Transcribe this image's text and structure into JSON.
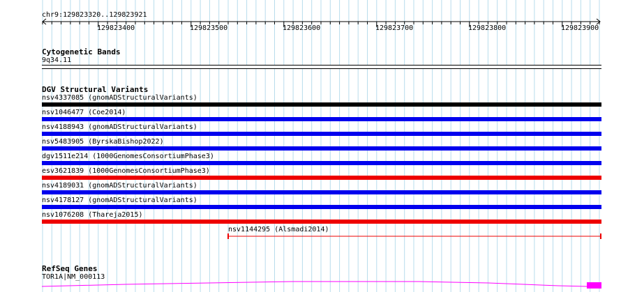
{
  "ruler": {
    "location": "chr9:129823320..129823921",
    "ticks": [
      "129823400",
      "129823500",
      "129823600",
      "129823700",
      "129823800",
      "129823900"
    ]
  },
  "tracks": {
    "cytoband": {
      "title": "Cytogenetic Bands",
      "band": "9q34.11"
    },
    "dgv": {
      "title": "DGV Structural Variants",
      "variants": [
        {
          "label": "nsv4337085 (gnomADStructuralVariants)",
          "color": "#000000"
        },
        {
          "label": "nsv1046477 (Coe2014)",
          "color": "#0000ee"
        },
        {
          "label": "nsv4188943 (gnomADStructuralVariants)",
          "color": "#0000ee"
        },
        {
          "label": "nsv5483905 (ByrskaBishop2022)",
          "color": "#0000ee"
        },
        {
          "label": "dgv1511e214 (1000GenomesConsortiumPhase3)",
          "color": "#0000ee"
        },
        {
          "label": "esv3621839 (1000GenomesConsortiumPhase3)",
          "color": "#ee0000"
        },
        {
          "label": "nsv4189031 (gnomADStructuralVariants)",
          "color": "#0000ee"
        },
        {
          "label": "nsv4178127 (gnomADStructuralVariants)",
          "color": "#0000ee"
        },
        {
          "label": "nsv1076208 (Thareja2015)",
          "color": "#ee0000"
        }
      ],
      "partial_variant": {
        "label": "nsv1144295 (Alsmadi2014)",
        "color": "#ee0000"
      }
    },
    "refseq": {
      "title": "RefSeq Genes",
      "gene": "TOR1A|NM_000113",
      "color": "#ff00ff"
    }
  },
  "colors": {
    "grid": "#b8dcec",
    "ruler": "#000000",
    "background": "#ffffff"
  }
}
